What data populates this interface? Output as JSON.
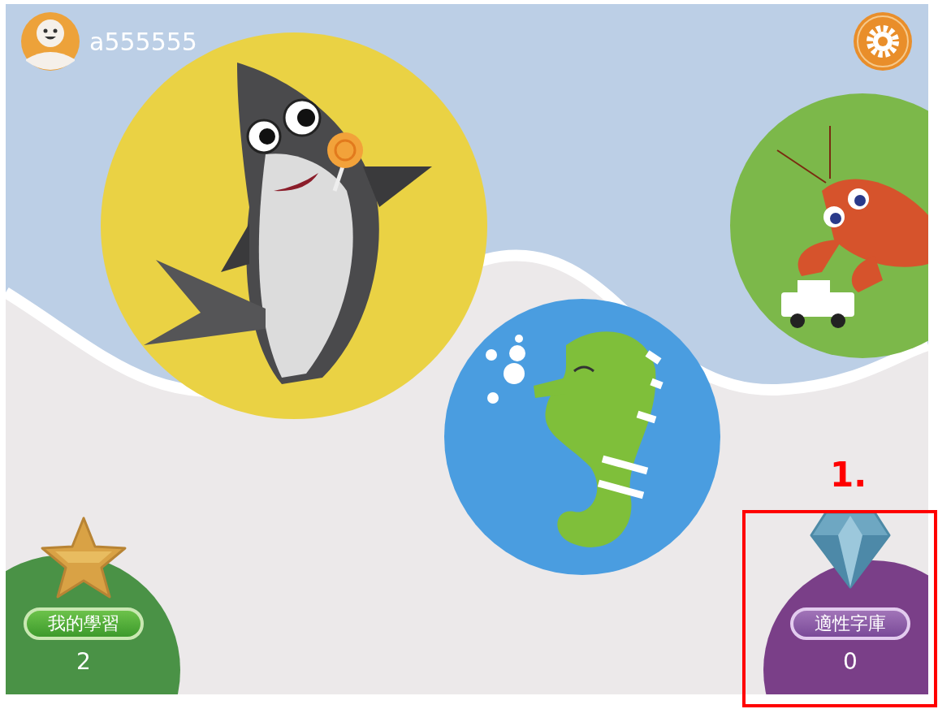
{
  "user": {
    "name": "a555555"
  },
  "tiles": [
    {
      "kind": "star",
      "label": "我的學習",
      "count": "2"
    },
    {
      "kind": "diamond",
      "label": "適性字庫",
      "count": "0"
    }
  ],
  "annotation": {
    "label": "1."
  }
}
